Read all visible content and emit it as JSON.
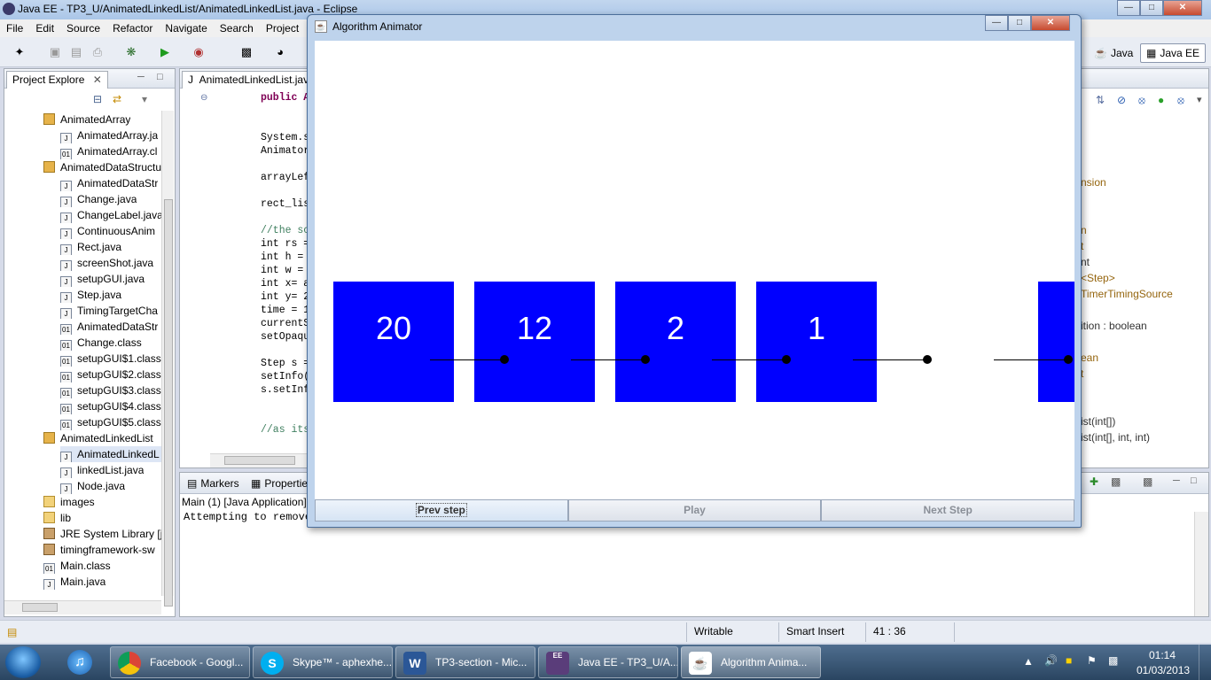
{
  "eclipse": {
    "title": "Java EE - TP3_U/AnimatedLinkedList/AnimatedLinkedList.java - Eclipse",
    "menu": [
      "File",
      "Edit",
      "Source",
      "Refactor",
      "Navigate",
      "Search",
      "Project"
    ],
    "perspectives": [
      "Java",
      "Java EE"
    ]
  },
  "explorer": {
    "tab": "Project Explore",
    "items": [
      {
        "label": "AnimatedArray",
        "icon": "package-icon"
      },
      {
        "label": "AnimatedArray.ja",
        "icon": "java-file-icon"
      },
      {
        "label": "AnimatedArray.cl",
        "icon": "class-file-icon"
      },
      {
        "label": "AnimatedDataStructu",
        "icon": "package-icon"
      },
      {
        "label": "AnimatedDataStr",
        "icon": "java-file-icon"
      },
      {
        "label": "Change.java",
        "icon": "java-file-icon"
      },
      {
        "label": "ChangeLabel.java",
        "icon": "java-file-icon"
      },
      {
        "label": "ContinuousAnim",
        "icon": "java-file-icon"
      },
      {
        "label": "Rect.java",
        "icon": "java-file-icon"
      },
      {
        "label": "screenShot.java",
        "icon": "java-file-icon"
      },
      {
        "label": "setupGUI.java",
        "icon": "java-file-icon"
      },
      {
        "label": "Step.java",
        "icon": "java-file-icon"
      },
      {
        "label": "TimingTargetCha",
        "icon": "java-file-icon"
      },
      {
        "label": "AnimatedDataStr",
        "icon": "class-file-icon"
      },
      {
        "label": "Change.class",
        "icon": "class-file-icon"
      },
      {
        "label": "setupGUI$1.class",
        "icon": "class-file-icon"
      },
      {
        "label": "setupGUI$2.class",
        "icon": "class-file-icon"
      },
      {
        "label": "setupGUI$3.class",
        "icon": "class-file-icon"
      },
      {
        "label": "setupGUI$4.class",
        "icon": "class-file-icon"
      },
      {
        "label": "setupGUI$5.class",
        "icon": "class-file-icon"
      },
      {
        "label": "AnimatedLinkedList",
        "icon": "package-icon"
      },
      {
        "label": "AnimatedLinkedL",
        "icon": "java-file-icon"
      },
      {
        "label": "linkedList.java",
        "icon": "java-file-icon"
      },
      {
        "label": "Node.java",
        "icon": "java-file-icon"
      },
      {
        "label": "images",
        "icon": "folder-icon"
      },
      {
        "label": "lib",
        "icon": "folder-icon"
      },
      {
        "label": "JRE System Library [jd",
        "icon": "library-icon"
      },
      {
        "label": "timingframework-sw",
        "icon": "jar-icon"
      },
      {
        "label": "Main.class",
        "icon": "class-file-icon"
      },
      {
        "label": "Main.java",
        "icon": "java-file-icon"
      }
    ]
  },
  "editor": {
    "tab": "AnimatedLinkedList.java",
    "lines": [
      {
        "text": "public A",
        "kind": "kw"
      },
      {
        "text": "System.s",
        "kind": "code"
      },
      {
        "text": "Animator",
        "kind": "code"
      },
      {
        "text": "arrayLef",
        "kind": "code"
      },
      {
        "text": "rect_lis",
        "kind": "code"
      },
      {
        "text": "//the sc",
        "kind": "comment"
      },
      {
        "text": "int rs =",
        "kind": "code"
      },
      {
        "text": "int h =",
        "kind": "code"
      },
      {
        "text": "int w =",
        "kind": "code"
      },
      {
        "text": "int x= a",
        "kind": "code"
      },
      {
        "text": "int y= 2",
        "kind": "code"
      },
      {
        "text": "time = 1",
        "kind": "code"
      },
      {
        "text": "currentS",
        "kind": "code"
      },
      {
        "text": "setOpaqu",
        "kind": "code"
      },
      {
        "text": "Step s =",
        "kind": "code"
      },
      {
        "text": "setInfo(",
        "kind": "code"
      },
      {
        "text": "s.setInf",
        "kind": "code"
      },
      {
        "text": "//as its",
        "kind": "comment"
      }
    ],
    "outline": [
      "nsion",
      "n",
      "t",
      "nt",
      "<Step>",
      "TimerTimingSource",
      "ition : boolean",
      "ean",
      "t",
      "ist(int[])",
      "ist(int[], int, int)"
    ]
  },
  "console": {
    "tabs": [
      "Markers",
      "Properties"
    ],
    "header": "Main (1) [Java Application]",
    "output": "Attempting to remove"
  },
  "status": {
    "writable": "Writable",
    "insert_mode": "Smart Insert",
    "position": "41 : 36"
  },
  "animator": {
    "title": "Algorithm Animator",
    "nodes": [
      "20",
      "12",
      "2",
      "1",
      ""
    ],
    "buttons": {
      "prev": "Prev step",
      "play": "Play",
      "next": "Next Step"
    },
    "colors": {
      "node": "#0000ff",
      "pointer": "#000000"
    }
  },
  "taskbar": {
    "items": [
      "Facebook - Googl...",
      "Skype™ - aphexhe...",
      "TP3-section - Mic...",
      "Java EE - TP3_U/A...",
      "Algorithm Anima..."
    ],
    "time": "01:14",
    "date": "01/03/2013"
  }
}
